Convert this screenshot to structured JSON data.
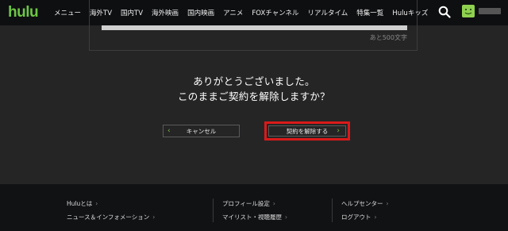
{
  "header": {
    "logo": "hulu",
    "nav": [
      "メニュー",
      "海外TV",
      "国内TV",
      "海外映画",
      "国内映画",
      "アニメ",
      "FOXチャンネル",
      "リアルタイム",
      "特集一覧",
      "Huluキッズ"
    ]
  },
  "comment": {
    "char_count": "あと500文字"
  },
  "message": {
    "line1": "ありがとうございました。",
    "line2": "このままご契約を解除しますか？"
  },
  "buttons": {
    "cancel": "キャンセル",
    "confirm": "契約を解除する"
  },
  "footer": {
    "col1": [
      "Huluとは",
      "ニュース＆インフォメーション"
    ],
    "col2": [
      "プロフィール設定",
      "マイリスト・視聴履歴"
    ],
    "col3": [
      "ヘルプセンター",
      "ログアウト"
    ]
  },
  "colors": {
    "brand": "#6cc644",
    "highlight": "#d91a1a",
    "header_bg": "#0e0f11",
    "body_bg": "#252526",
    "footer_bg": "#111214"
  },
  "icons": [
    "search-icon",
    "avatar",
    "chevron-left-icon",
    "chevron-right-icon"
  ]
}
